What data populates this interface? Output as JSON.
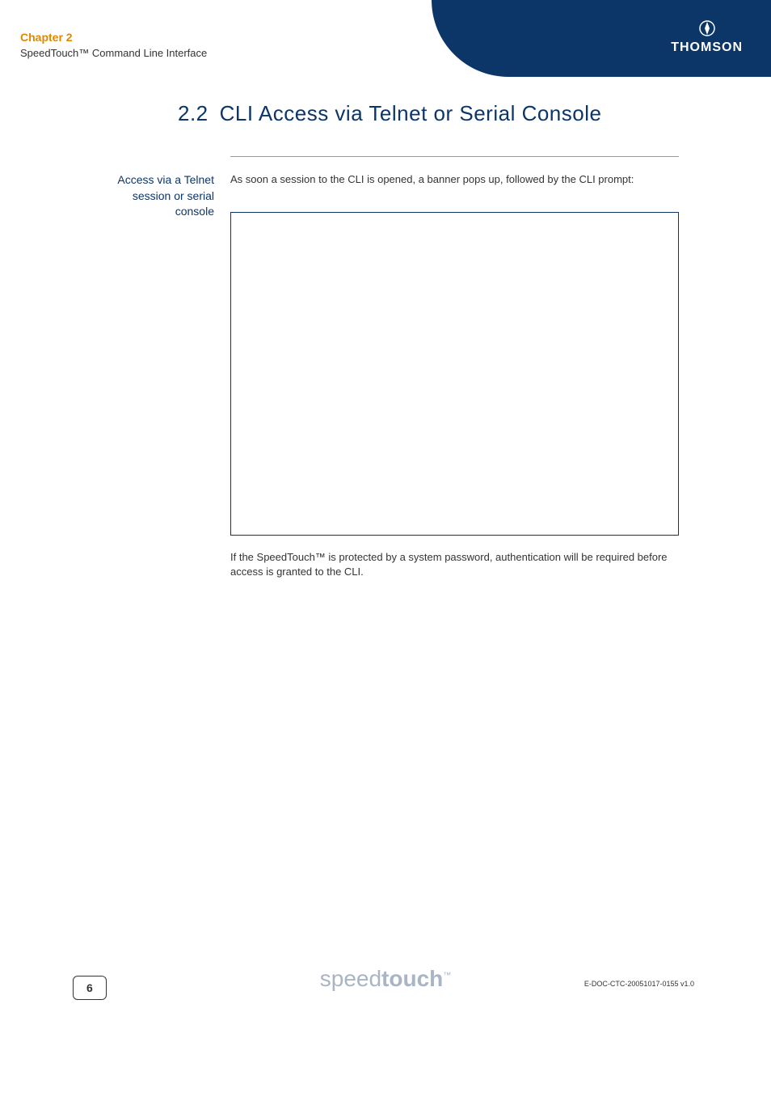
{
  "header": {
    "chapter_title": "Chapter 2",
    "chapter_subtitle": "SpeedTouch™ Command Line Interface",
    "brand": "THOMSON"
  },
  "section": {
    "number": "2.2",
    "title": "CLI Access via Telnet or Serial Console"
  },
  "side_label": "Access via a Telnet session or serial console",
  "body": {
    "paragraph1": "As soon a session to the CLI is opened, a banner pops up, followed by the CLI prompt:",
    "paragraph2": "If the SpeedTouch™ is protected by a system password, authentication will be required before access is granted to the CLI."
  },
  "footer": {
    "logo_thin": "speed",
    "logo_bold": "touch",
    "logo_tm": "™",
    "page_number": "6",
    "doc_code": "E-DOC-CTC-20051017-0155 v1.0"
  }
}
